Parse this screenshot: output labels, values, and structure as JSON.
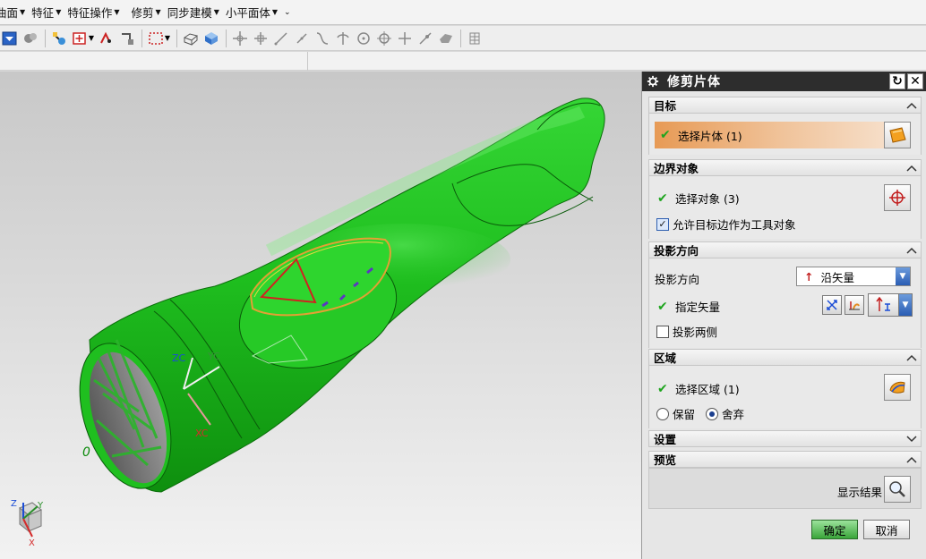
{
  "menubar": {
    "items": [
      {
        "label": "曲面"
      },
      {
        "label": "特征"
      },
      {
        "label": "特征操作"
      },
      {
        "label": "修剪"
      },
      {
        "label": "同步建模"
      },
      {
        "label": "小平面体"
      }
    ]
  },
  "viewport": {
    "wcs_labels": {
      "zc": "ZC",
      "yc": "YC",
      "xc": "XC"
    },
    "origin_label": "0",
    "triad_labels": {
      "z": "Z",
      "y": "Y",
      "x": "X"
    },
    "body_color": "#1fbf1f"
  },
  "dialog": {
    "title": "修剪片体",
    "sections": {
      "target": {
        "header": "目标",
        "select_label": "选择片体 (1)"
      },
      "boundary": {
        "header": "边界对象",
        "select_label": "选择对象 (3)",
        "allow_edge_label": "允许目标边作为工具对象",
        "allow_edge_checked": true
      },
      "projection": {
        "header": "投影方向",
        "direction_label": "投影方向",
        "direction_value": "沿矢量",
        "vector_label": "指定矢量",
        "both_sides_label": "投影两侧",
        "both_sides_checked": false
      },
      "region": {
        "header": "区域",
        "select_label": "选择区域 (1)",
        "keep_label": "保留",
        "discard_label": "舍弃",
        "selected": "discard"
      },
      "settings": {
        "header": "设置"
      },
      "preview": {
        "header": "预览",
        "show_result_label": "显示结果"
      }
    },
    "ok_label": "确定",
    "cancel_label": "取消",
    "colors": {
      "accent": "#e79a55",
      "title_bar": "#2d2d2d",
      "ok_button": "#3aa53a"
    }
  }
}
